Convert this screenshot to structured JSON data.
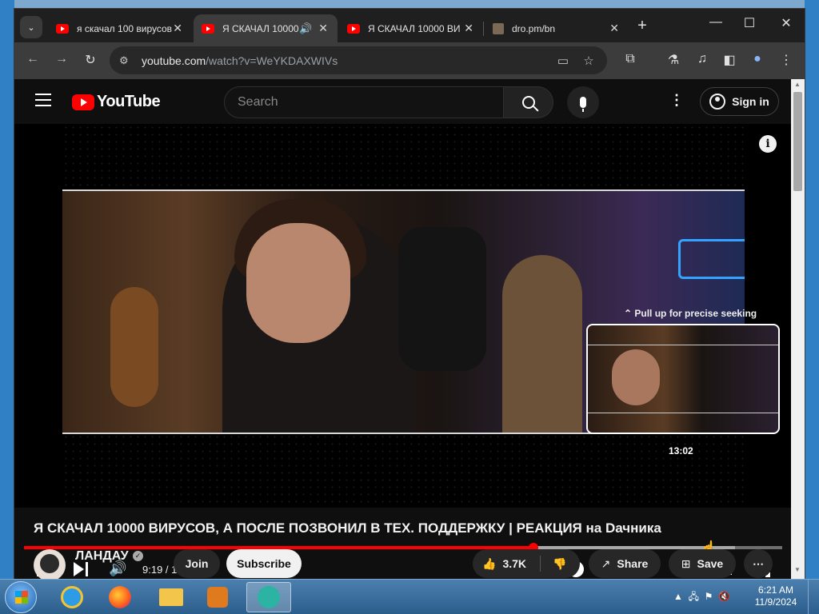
{
  "browser": {
    "tabs": [
      {
        "title": "я скачал 100 вирусов",
        "favicon": "youtube-icon",
        "active": false
      },
      {
        "title": "Я СКАЧАЛ 10000",
        "favicon": "youtube-icon",
        "active": true,
        "audio": true
      },
      {
        "title": "Я СКАЧАЛ 10000 ВИ",
        "favicon": "youtube-icon",
        "active": false
      },
      {
        "title": "dro.pm/bn",
        "favicon": "document-icon",
        "active": false
      }
    ],
    "address": {
      "domain": "youtube.com",
      "path": "/watch?v=WeYKDAXWIVs"
    }
  },
  "youtube": {
    "logo_text": "YouTube",
    "search_placeholder": "Search",
    "signin_label": "Sign in"
  },
  "player": {
    "seek_hint": "⌃ Pull up for precise seeking",
    "preview_time": "13:02",
    "time_display": "9:19 / 13:52",
    "progress": {
      "played_fraction": 0.672,
      "buffered_fraction": 0.938,
      "hover_fraction": 0.892
    },
    "accent_color": "#ff0000"
  },
  "video": {
    "title": "Я СКАЧАЛ 10000 ВИРУСОВ, А ПОСЛЕ ПОЗВОНИЛ В ТЕХ. ПОДДЕРЖКУ | РЕАКЦИЯ на Dачника",
    "channel": "ЛАНДАУ",
    "join_label": "Join",
    "subscribe_label": "Subscribe",
    "likes": "3.7K",
    "share_label": "Share",
    "save_label": "Save"
  },
  "taskbar": {
    "time": "6:21 AM",
    "date": "11/9/2024"
  }
}
